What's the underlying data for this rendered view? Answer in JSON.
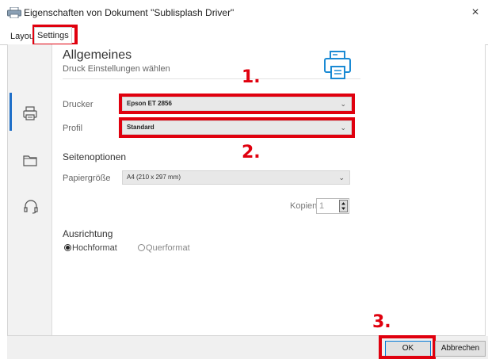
{
  "window": {
    "title": "Eigenschaften von Dokument \"Sublisplash Driver\"",
    "close_glyph": "×"
  },
  "tabs": [
    {
      "label": "Layout",
      "active": false
    },
    {
      "label": "Settings",
      "active": true
    }
  ],
  "header": {
    "title": "Allgemeines",
    "subtitle": "Druck Einstellungen wählen"
  },
  "form": {
    "drucker_label": "Drucker",
    "drucker_value": "Epson ET 2856",
    "profil_label": "Profil",
    "profil_value": "Standard",
    "seitenoptionen_heading": "Seitenoptionen",
    "papier_label": "Papiergröße",
    "papier_value": "A4 (210 x 297 mm)",
    "kopien_label": "Kopien",
    "kopien_value": "1",
    "ausrichtung_heading": "Ausrichtung",
    "orientation_options": [
      {
        "label": "Hochformat",
        "selected": true
      },
      {
        "label": "Querformat",
        "selected": false
      }
    ]
  },
  "buttons": {
    "ok": "OK",
    "cancel": "Abbrechen"
  },
  "annotations": [
    "1.",
    "2.",
    "3."
  ],
  "sidebar_icons": [
    "printer-icon",
    "folder-icon",
    "headset-icon"
  ],
  "colors": {
    "annotation_red": "#e0000e",
    "accent_blue": "#1f6fc8"
  }
}
